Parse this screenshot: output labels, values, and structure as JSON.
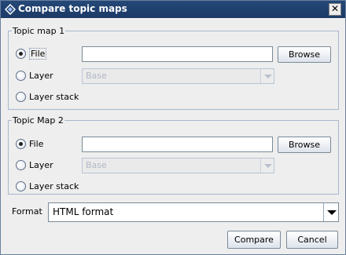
{
  "window": {
    "title": "Compare topic maps",
    "close_label": "✕"
  },
  "group1": {
    "legend": "Topic map 1",
    "file_label": "File",
    "file_value": "",
    "browse_label": "Browse",
    "layer_label": "Layer",
    "layer_value": "Base",
    "layer_stack_label": "Layer stack",
    "selected": "File"
  },
  "group2": {
    "legend": "Topic Map 2",
    "file_label": "File",
    "file_value": "",
    "browse_label": "Browse",
    "layer_label": "Layer",
    "layer_value": "Base",
    "layer_stack_label": "Layer stack",
    "selected": "File"
  },
  "format": {
    "label": "Format",
    "value": "HTML format"
  },
  "buttons": {
    "compare": "Compare",
    "cancel": "Cancel"
  }
}
